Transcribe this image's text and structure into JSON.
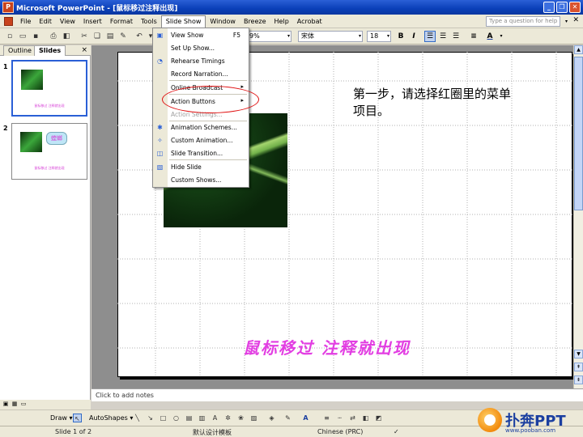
{
  "window": {
    "title": "Microsoft PowerPoint - [鼠标移过注释出现]",
    "buttons": {
      "minimize": "_",
      "restore": "❐",
      "close": "✕"
    }
  },
  "menubar": {
    "items": [
      "File",
      "Edit",
      "View",
      "Insert",
      "Format",
      "Tools",
      "Slide Show",
      "Window",
      "Breeze",
      "Help",
      "Acrobat"
    ],
    "question_placeholder": "Type a question for help",
    "close_label": "✕"
  },
  "toolbar": {
    "zoom": "9%",
    "font": "宋体",
    "font_size": "18",
    "bold": "B",
    "italic": "I",
    "font_color": "A"
  },
  "slide_show_menu": {
    "items": [
      {
        "label": "View Show",
        "shortcut": "F5",
        "icon": "view-show-icon"
      },
      {
        "label": "Set Up Show...",
        "icon": ""
      },
      {
        "label": "Rehearse Timings",
        "icon": "rehearse-icon"
      },
      {
        "label": "Record Narration...",
        "icon": ""
      },
      {
        "label": "Online Broadcast",
        "submenu": "▸"
      },
      {
        "label": "Action Buttons",
        "submenu": "▸"
      },
      {
        "label": "Action Settings...",
        "disabled": true
      },
      {
        "label": "Animation Schemes...",
        "icon": "animation-schemes-icon"
      },
      {
        "label": "Custom Animation...",
        "icon": "custom-animation-icon"
      },
      {
        "label": "Slide Transition...",
        "icon": "slide-transition-icon"
      },
      {
        "label": "Hide Slide",
        "icon": "hide-slide-icon"
      },
      {
        "label": "Custom Shows...",
        "icon": ""
      }
    ]
  },
  "left_pane": {
    "tabs": [
      "Outline",
      "Slides"
    ],
    "close_label": "×",
    "slides": [
      {
        "number": "1",
        "caption": "鼠标移过 注释就出现"
      },
      {
        "number": "2",
        "caption": "鼠标移过 注释就出现",
        "callout": "螳螂"
      }
    ]
  },
  "slide": {
    "annotation": "第一步，请选择红圈里的菜单项目。",
    "caption": "鼠标移过 注释就出现"
  },
  "notes": {
    "placeholder": "Click to add notes"
  },
  "drawbar": {
    "draw_label": "Draw ▾",
    "autoshapes_label": "AutoShapes ▾"
  },
  "statusbar": {
    "slide_info": "Slide 1 of 2",
    "design": "默认设计模板",
    "language": "Chinese (PRC)"
  },
  "logo": {
    "text": "扑奔PPT",
    "url": "www.pooban.com"
  },
  "colors": {
    "titlebar": "#0a3fb8",
    "caption_pink": "#e23ee2",
    "highlight_red": "#e01010"
  }
}
